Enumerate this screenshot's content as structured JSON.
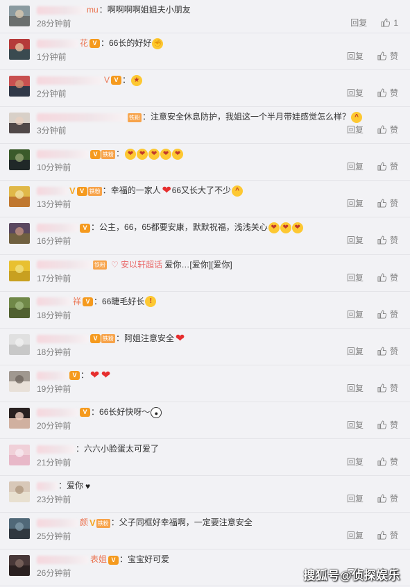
{
  "comments": [
    {
      "name_suffix": "mu",
      "has_badge": false,
      "has_v": false,
      "has_fan": false,
      "text": "啊啊啊啊姐姐夫小朋友",
      "emojis": [],
      "tag": "",
      "time": "28分钟前",
      "reply": "回复",
      "like": "1",
      "av": [
        "#8a9aa0",
        "#6b6f6e",
        "#d8c8b0"
      ]
    },
    {
      "name_suffix": "花",
      "has_badge": true,
      "has_v": false,
      "has_fan": false,
      "text": "66长的好好",
      "emojis": [
        "fist"
      ],
      "tag": "",
      "time": "1分钟前",
      "reply": "回复",
      "like": "赞",
      "av": [
        "#b53a3a",
        "#3a4a50",
        "#e8c0a0"
      ]
    },
    {
      "name_suffix": "V",
      "has_badge": true,
      "has_v": false,
      "has_fan": false,
      "text": "",
      "emojis": [
        "cheer"
      ],
      "tag": "",
      "time": "2分钟前",
      "reply": "回复",
      "like": "赞",
      "av": [
        "#c85050",
        "#303848",
        "#d09070"
      ]
    },
    {
      "name_suffix": "",
      "has_badge": false,
      "has_v": false,
      "has_fan": true,
      "text": "注意安全休息防护，我姐这一个半月带娃感觉怎么样？",
      "emojis": [
        "grin"
      ],
      "tag": "",
      "time": "3分钟前",
      "reply": "回复",
      "like": "赞",
      "av": [
        "#d8d0c8",
        "#504848",
        "#e8d0c0"
      ]
    },
    {
      "name_suffix": "",
      "has_badge": true,
      "has_v": false,
      "has_fan": true,
      "text": "",
      "emojis": [
        "kiss",
        "kiss",
        "kiss",
        "kiss",
        "kiss"
      ],
      "tag": "",
      "time": "10分钟前",
      "reply": "回复",
      "like": "赞",
      "av": [
        "#3a5a2a",
        "#202828",
        "#90a070"
      ]
    },
    {
      "name_suffix": "",
      "has_badge": true,
      "has_v": true,
      "has_fan": true,
      "text": "幸福的一家人",
      "emojis": [
        "heart"
      ],
      "text2": "66又长大了不少",
      "emojis2": [
        "grin"
      ],
      "tag": "",
      "time": "13分钟前",
      "reply": "回复",
      "like": "赞",
      "av": [
        "#e0b848",
        "#c07830",
        "#f0e0a0"
      ]
    },
    {
      "name_suffix": "",
      "has_badge": true,
      "has_v": false,
      "has_fan": false,
      "text": "公主，66，65都要安康，默默祝福，浅浅关心",
      "emojis": [
        "kiss",
        "kiss",
        "kiss"
      ],
      "tag": "",
      "time": "16分钟前",
      "reply": "回复",
      "like": "赞",
      "av": [
        "#5a4860",
        "#706040",
        "#c09080"
      ]
    },
    {
      "name_suffix": "",
      "has_badge": false,
      "has_v": false,
      "has_fan": true,
      "text": "",
      "emojis": [],
      "tag": "安以轩超话",
      "text_after": "爱你…[爱你][爱你]",
      "time": "17分钟前",
      "reply": "回复",
      "like": "赞",
      "av": [
        "#e8c030",
        "#c8a020",
        "#f0e080"
      ]
    },
    {
      "name_suffix": "祥",
      "has_badge": true,
      "has_v": false,
      "has_fan": false,
      "text": "66睫毛好长",
      "emojis": [
        "shock"
      ],
      "tag": "",
      "time": "18分钟前",
      "reply": "回复",
      "like": "赞",
      "av": [
        "#708848",
        "#506030",
        "#a0b880"
      ]
    },
    {
      "name_suffix": "",
      "has_badge": true,
      "has_v": false,
      "has_fan": true,
      "text": "阿姐注意安全",
      "emojis": [
        "heart"
      ],
      "tag": "",
      "time": "18分钟前",
      "reply": "回复",
      "like": "赞",
      "av": [
        "#e0e0e0",
        "#c8c8c8",
        "#f0f0f0"
      ]
    },
    {
      "name_suffix": "",
      "has_badge": true,
      "has_v": false,
      "has_fan": false,
      "text": "",
      "emojis": [
        "heart",
        "heart"
      ],
      "tag": "",
      "time": "19分钟前",
      "reply": "回复",
      "like": "赞",
      "av": [
        "#a09890",
        "#e8e0d8",
        "#706860"
      ]
    },
    {
      "name_suffix": "",
      "has_badge": true,
      "has_v": false,
      "has_fan": false,
      "text": "66长好快呀～",
      "emojis": [
        "panda"
      ],
      "tag": "",
      "time": "20分钟前",
      "reply": "回复",
      "like": "赞",
      "av": [
        "#282020",
        "#d0b0a0",
        "#f0d0c0"
      ]
    },
    {
      "name_suffix": "",
      "has_badge": false,
      "has_v": false,
      "has_fan": false,
      "text": "六六小脸蛋太可爱了",
      "emojis": [],
      "tag": "",
      "time": "21分钟前",
      "reply": "回复",
      "like": "赞",
      "av": [
        "#f0d0d8",
        "#e8b8c8",
        "#f8e8f0"
      ]
    },
    {
      "name_suffix": "",
      "has_badge": false,
      "has_v": false,
      "has_fan": false,
      "text": "爱你",
      "emojis": [
        "blackheart"
      ],
      "tag": "",
      "time": "23分钟前",
      "reply": "回复",
      "like": "赞",
      "av": [
        "#d8c8b8",
        "#e8e0d0",
        "#b09880"
      ]
    },
    {
      "name_suffix": "颜",
      "has_badge": false,
      "has_v": true,
      "has_fan": true,
      "text": "父子同框好幸福啊，一定要注意安全",
      "emojis": [],
      "tag": "",
      "time": "25分钟前",
      "reply": "回复",
      "like": "赞",
      "av": [
        "#506878",
        "#303840",
        "#8098a8"
      ]
    },
    {
      "name_suffix": "表姐",
      "has_badge": true,
      "has_v": false,
      "has_fan": false,
      "text": "宝宝好可爱",
      "emojis": [],
      "tag": "",
      "time": "26分钟前",
      "reply": "回复",
      "like": "赞",
      "av": [
        "#483838",
        "#2a2020",
        "#806860"
      ]
    }
  ],
  "labels": {
    "fan": "铁粉",
    "badge": "V",
    "v": "V",
    "colon": "："
  },
  "watermark": "搜狐号@侦探娱乐",
  "colors": {
    "name": "#eb7350",
    "tag": "#e96a6a",
    "meta": "#808080",
    "bg": "#f2f2f5"
  }
}
